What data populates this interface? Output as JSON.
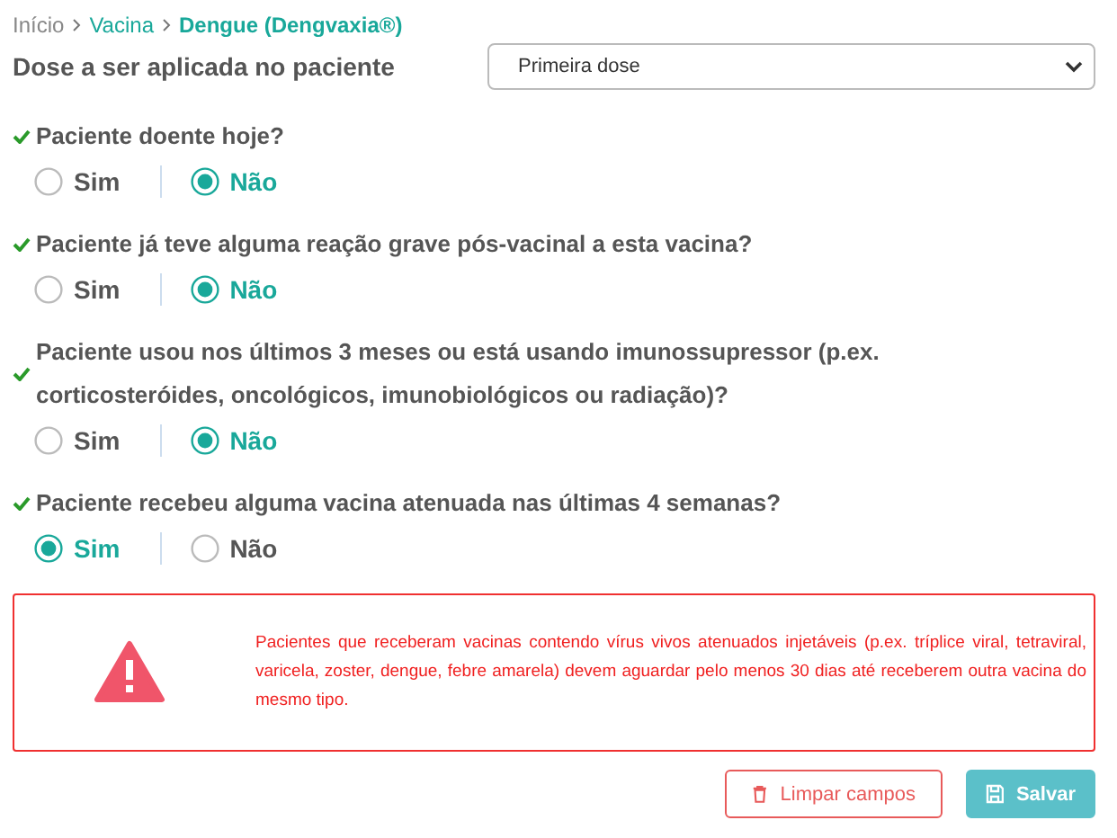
{
  "breadcrumb": [
    {
      "label": "Início",
      "current": false
    },
    {
      "label": "Vacina",
      "current": false
    },
    {
      "label": "Dengue (Dengvaxia®)",
      "current": true
    }
  ],
  "dose": {
    "label": "Dose a ser aplicada no paciente",
    "value": "Primeira dose"
  },
  "questions": [
    {
      "text": "Paciente doente hoje?",
      "answered": true,
      "options": [
        {
          "label": "Sim",
          "selected": false
        },
        {
          "label": "Não",
          "selected": true
        }
      ]
    },
    {
      "text": "Paciente já teve alguma reação grave pós-vacinal a esta vacina?",
      "answered": true,
      "options": [
        {
          "label": "Sim",
          "selected": false
        },
        {
          "label": "Não",
          "selected": true
        }
      ]
    },
    {
      "text": "Paciente usou nos últimos 3 meses ou está usando imunossupressor (p.ex. corticosteróides, oncológicos, imunobiológicos ou radiação)?",
      "answered": true,
      "options": [
        {
          "label": "Sim",
          "selected": false
        },
        {
          "label": "Não",
          "selected": true
        }
      ]
    },
    {
      "text": "Paciente recebeu alguma vacina atenuada nas últimas 4 semanas?",
      "answered": true,
      "options": [
        {
          "label": "Sim",
          "selected": true
        },
        {
          "label": "Não",
          "selected": false
        }
      ]
    }
  ],
  "warning": {
    "text": "Pacientes que receberam vacinas contendo vírus vivos atenuados injetáveis (p.ex. tríplice viral, tetraviral, varicela, zoster, dengue, febre amarela) devem aguardar pelo menos 30 dias até receberem outra vacina do mesmo tipo."
  },
  "buttons": [
    {
      "label": "Limpar campos",
      "kind": "clear"
    },
    {
      "label": "Salvar",
      "kind": "save"
    }
  ]
}
